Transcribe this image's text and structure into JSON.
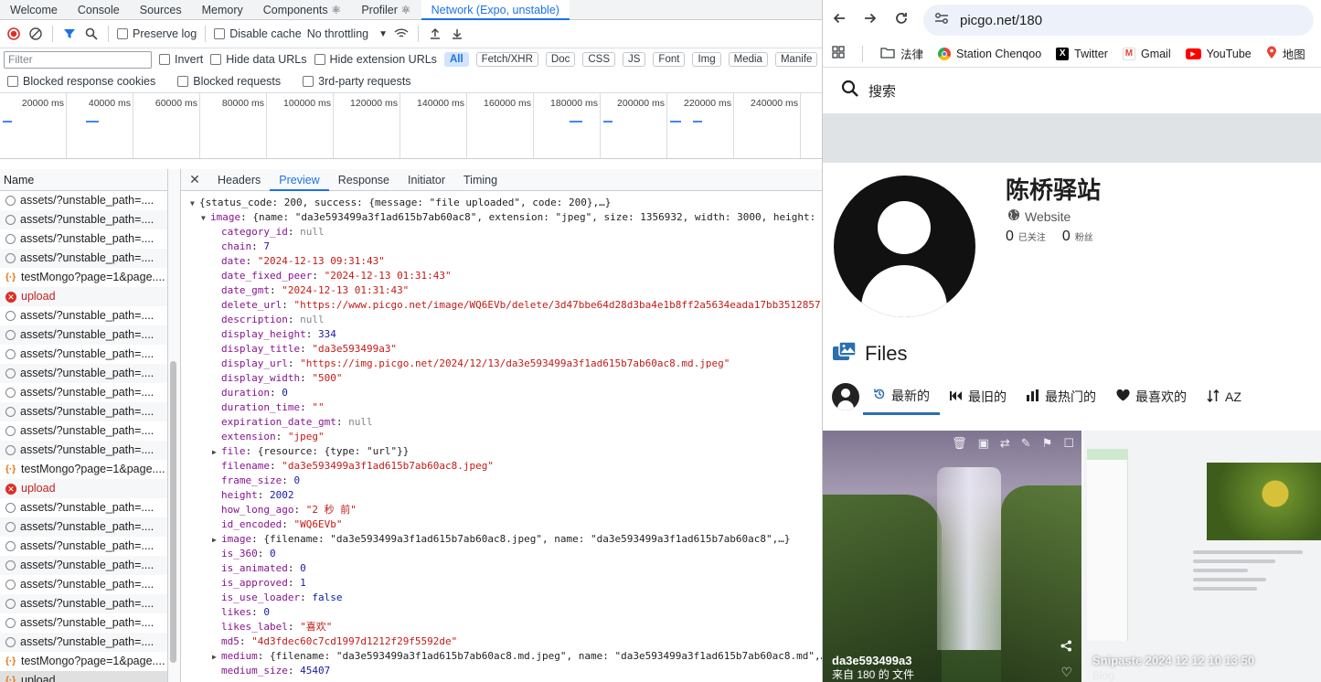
{
  "devtools": {
    "tabs": [
      "Welcome",
      "Console",
      "Sources",
      "Memory",
      "Components ⚛",
      "Profiler ⚛",
      "Network (Expo, unstable)"
    ],
    "active_tab_index": 6,
    "toolbar": {
      "preserve_log": "Preserve log",
      "disable_cache": "Disable cache",
      "throttling": "No throttling"
    },
    "filter": {
      "placeholder": "Filter",
      "invert": "Invert",
      "hide_data_urls": "Hide data URLs",
      "hide_extension_urls": "Hide extension URLs",
      "types": [
        "All",
        "Fetch/XHR",
        "Doc",
        "CSS",
        "JS",
        "Font",
        "Img",
        "Media",
        "Manife"
      ]
    },
    "blocked": {
      "cookies": "Blocked response cookies",
      "requests": "Blocked requests",
      "third_party": "3rd-party requests"
    },
    "timeline_ticks": [
      "20000 ms",
      "40000 ms",
      "60000 ms",
      "80000 ms",
      "100000 ms",
      "120000 ms",
      "140000 ms",
      "160000 ms",
      "180000 ms",
      "200000 ms",
      "220000 ms",
      "240000 ms"
    ],
    "request_list": {
      "header": "Name",
      "rows": [
        {
          "name": "assets/?unstable_path=....",
          "type": "asset"
        },
        {
          "name": "assets/?unstable_path=....",
          "type": "asset"
        },
        {
          "name": "assets/?unstable_path=....",
          "type": "asset"
        },
        {
          "name": "assets/?unstable_path=....",
          "type": "asset"
        },
        {
          "name": "testMongo?page=1&page....",
          "type": "json"
        },
        {
          "name": "upload",
          "type": "error"
        },
        {
          "name": "assets/?unstable_path=....",
          "type": "asset"
        },
        {
          "name": "assets/?unstable_path=....",
          "type": "asset"
        },
        {
          "name": "assets/?unstable_path=....",
          "type": "asset"
        },
        {
          "name": "assets/?unstable_path=....",
          "type": "asset"
        },
        {
          "name": "assets/?unstable_path=....",
          "type": "asset"
        },
        {
          "name": "assets/?unstable_path=....",
          "type": "asset"
        },
        {
          "name": "assets/?unstable_path=....",
          "type": "asset"
        },
        {
          "name": "assets/?unstable_path=....",
          "type": "asset"
        },
        {
          "name": "testMongo?page=1&page....",
          "type": "json"
        },
        {
          "name": "upload",
          "type": "error"
        },
        {
          "name": "assets/?unstable_path=....",
          "type": "asset"
        },
        {
          "name": "assets/?unstable_path=....",
          "type": "asset"
        },
        {
          "name": "assets/?unstable_path=....",
          "type": "asset"
        },
        {
          "name": "assets/?unstable_path=....",
          "type": "asset"
        },
        {
          "name": "assets/?unstable_path=....",
          "type": "asset"
        },
        {
          "name": "assets/?unstable_path=....",
          "type": "asset"
        },
        {
          "name": "assets/?unstable_path=....",
          "type": "asset"
        },
        {
          "name": "assets/?unstable_path=....",
          "type": "asset"
        },
        {
          "name": "testMongo?page=1&page....",
          "type": "json"
        },
        {
          "name": "upload",
          "type": "json",
          "selected": true
        }
      ]
    },
    "detail_tabs": [
      "Headers",
      "Preview",
      "Response",
      "Initiator",
      "Timing"
    ],
    "active_detail_tab_index": 1,
    "preview": [
      {
        "indent": 0,
        "toggle": "open",
        "root": true,
        "text": "{status_code: 200, success: {message: \"file uploaded\", code: 200},…}"
      },
      {
        "indent": 1,
        "toggle": "open",
        "key": "image",
        "text": "{name: \"da3e593499a3f1ad615b7ab60ac8\", extension: \"jpeg\", size: 1356932, width: 3000, height:",
        "kind": "p"
      },
      {
        "indent": 2,
        "key": "category_id",
        "text": "null",
        "kind": "nl"
      },
      {
        "indent": 2,
        "key": "chain",
        "text": "7",
        "kind": "n"
      },
      {
        "indent": 2,
        "key": "date",
        "text": "\"2024-12-13 09:31:43\"",
        "kind": "s"
      },
      {
        "indent": 2,
        "key": "date_fixed_peer",
        "text": "\"2024-12-13 01:31:43\"",
        "kind": "s"
      },
      {
        "indent": 2,
        "key": "date_gmt",
        "text": "\"2024-12-13 01:31:43\"",
        "kind": "s"
      },
      {
        "indent": 2,
        "key": "delete_url",
        "text": "\"https://www.picgo.net/image/WQ6EVb/delete/3d47bbe64d28d3ba4e1b8ff2a5634eada17bb3512857",
        "kind": "s"
      },
      {
        "indent": 2,
        "key": "description",
        "text": "null",
        "kind": "nl"
      },
      {
        "indent": 2,
        "key": "display_height",
        "text": "334",
        "kind": "n"
      },
      {
        "indent": 2,
        "key": "display_title",
        "text": "\"da3e593499a3\"",
        "kind": "s"
      },
      {
        "indent": 2,
        "key": "display_url",
        "text": "\"https://img.picgo.net/2024/12/13/da3e593499a3f1ad615b7ab60ac8.md.jpeg\"",
        "kind": "s"
      },
      {
        "indent": 2,
        "key": "display_width",
        "text": "\"500\"",
        "kind": "s"
      },
      {
        "indent": 2,
        "key": "duration",
        "text": "0",
        "kind": "n"
      },
      {
        "indent": 2,
        "key": "duration_time",
        "text": "\"\"",
        "kind": "s"
      },
      {
        "indent": 2,
        "key": "expiration_date_gmt",
        "text": "null",
        "kind": "nl"
      },
      {
        "indent": 2,
        "key": "extension",
        "text": "\"jpeg\"",
        "kind": "s"
      },
      {
        "indent": 2,
        "toggle": "closed",
        "key": "file",
        "text": "{resource: {type: \"url\"}}",
        "kind": "p"
      },
      {
        "indent": 2,
        "key": "filename",
        "text": "\"da3e593499a3f1ad615b7ab60ac8.jpeg\"",
        "kind": "s"
      },
      {
        "indent": 2,
        "key": "frame_size",
        "text": "0",
        "kind": "n"
      },
      {
        "indent": 2,
        "key": "height",
        "text": "2002",
        "kind": "n"
      },
      {
        "indent": 2,
        "key": "how_long_ago",
        "text": "\"2 秒 前\"",
        "kind": "s"
      },
      {
        "indent": 2,
        "key": "id_encoded",
        "text": "\"WQ6EVb\"",
        "kind": "s"
      },
      {
        "indent": 2,
        "toggle": "closed",
        "key": "image",
        "text": "{filename: \"da3e593499a3f1ad615b7ab60ac8.jpeg\", name: \"da3e593499a3f1ad615b7ab60ac8\",…}",
        "kind": "p"
      },
      {
        "indent": 2,
        "key": "is_360",
        "text": "0",
        "kind": "n"
      },
      {
        "indent": 2,
        "key": "is_animated",
        "text": "0",
        "kind": "n"
      },
      {
        "indent": 2,
        "key": "is_approved",
        "text": "1",
        "kind": "n"
      },
      {
        "indent": 2,
        "key": "is_use_loader",
        "text": "false",
        "kind": "b"
      },
      {
        "indent": 2,
        "key": "likes",
        "text": "0",
        "kind": "n"
      },
      {
        "indent": 2,
        "key": "likes_label",
        "text": "\"喜欢\"",
        "kind": "s"
      },
      {
        "indent": 2,
        "key": "md5",
        "text": "\"4d3fdec60c7cd1997d1212f29f5592de\"",
        "kind": "s"
      },
      {
        "indent": 2,
        "toggle": "closed",
        "key": "medium",
        "text": "{filename: \"da3e593499a3f1ad615b7ab60ac8.md.jpeg\", name: \"da3e593499a3f1ad615b7ab60ac8.md\",…}",
        "kind": "p"
      },
      {
        "indent": 2,
        "key": "medium_size",
        "text": "45407",
        "kind": "n"
      }
    ]
  },
  "browser": {
    "url": "picgo.net/180",
    "bookmarks": [
      {
        "label": "法律",
        "icon": "folder-icon"
      },
      {
        "label": "Station Chenqoo",
        "icon": "chrome-icon"
      },
      {
        "label": "Twitter",
        "icon": "x-icon"
      },
      {
        "label": "Gmail",
        "icon": "gmail-icon"
      },
      {
        "label": "YouTube",
        "icon": "youtube-icon"
      },
      {
        "label": "地图",
        "icon": "maps-icon"
      }
    ],
    "search_label": "搜索",
    "profile": {
      "name": "陈桥驿站",
      "website": "Website",
      "following_count": "0",
      "following_label": "已关注",
      "followers_count": "0",
      "followers_label": "粉丝"
    },
    "files_title": "Files",
    "sort_tabs": [
      {
        "label": "最新的",
        "icon": "history-icon"
      },
      {
        "label": "最旧的",
        "icon": "rewind-icon"
      },
      {
        "label": "最热门的",
        "icon": "bar-chart-icon"
      },
      {
        "label": "最喜欢的",
        "icon": "heart-icon"
      },
      {
        "label": "AZ",
        "icon": "sort-icon"
      }
    ],
    "active_sort_index": 0,
    "cards": [
      {
        "title": "da3e593499a3",
        "subtitle": "来自 180 的 文件"
      },
      {
        "title": "Snipaste 2024 12 12 10 13 50",
        "subtitle": "Blog"
      }
    ]
  },
  "colors": {
    "accent": "#1a73e8",
    "error": "#d93025",
    "sort_underline": "#2a6fb0"
  }
}
